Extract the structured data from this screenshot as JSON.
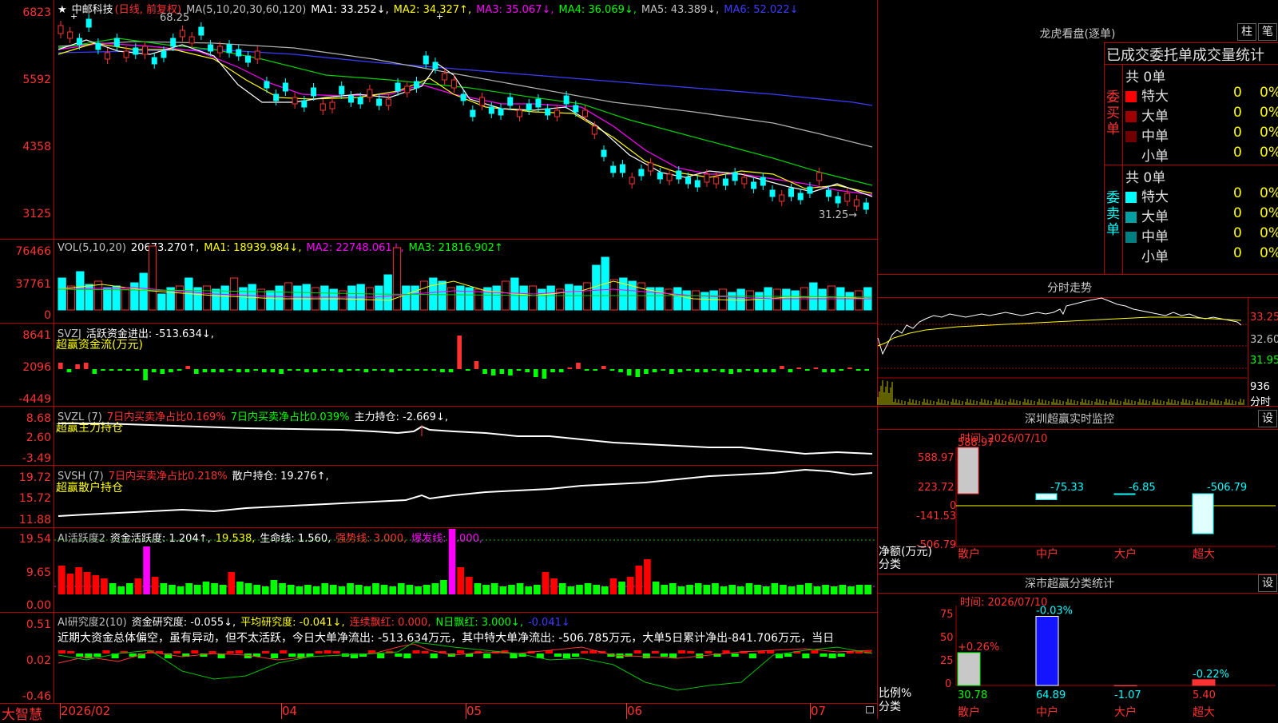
{
  "stock": {
    "star": "★",
    "name": "中邮科技",
    "period": "(日线, 前复权)",
    "high_mark": "68.25",
    "low_mark": "31.25→"
  },
  "ma_line": {
    "label": "MA(5,10,20,30,60,120)",
    "items": [
      {
        "text": "MA1: 33.252↓,",
        "color": "#ffffff"
      },
      {
        "text": "MA2: 34.327↑,",
        "color": "#ffff00"
      },
      {
        "text": "MA3: 35.067↓,",
        "color": "#ff00ff"
      },
      {
        "text": "MA4: 36.069↓,",
        "color": "#00ff00"
      },
      {
        "text": "MA5: 43.389↓,",
        "color": "#c0c0c0"
      },
      {
        "text": "MA6: 52.022↓",
        "color": "#3c3cff"
      }
    ]
  },
  "panels": {
    "kline": {
      "yticks": [
        "6823",
        "5592",
        "4358",
        "3125"
      ]
    },
    "vol": {
      "yticks": [
        "76466",
        "37761",
        "0"
      ],
      "label": "VOL(5,10,20)",
      "value": "20673.270↑,",
      "ma1": "MA1: 18939.984↓,",
      "ma2": "MA2: 22748.061↓,",
      "ma3": "MA3: 21816.902↑"
    },
    "svzj": {
      "yticks": [
        "8641",
        "2096",
        "-4449"
      ],
      "label": "SVZJ",
      "value": "活跃资金进出: -513.634↓,",
      "sub": "超赢资金流(万元)"
    },
    "svzl": {
      "yticks": [
        "8.68",
        "2.60",
        "-3.49"
      ],
      "label": "SVZL (7)",
      "a": "7日内买卖净占比0.169%",
      "b": "7日内买卖净占比0.039%",
      "c": "主力持仓: -2.669↓,",
      "sub": "超赢主力持仓"
    },
    "svsh": {
      "yticks": [
        "19.72",
        "15.72",
        "11.88"
      ],
      "label": "SVSH (7)",
      "a": "7日内买卖净占比0.218%",
      "b": "散户持仓: 19.276↑,",
      "sub": "超赢散户持仓"
    },
    "ai1": {
      "yticks": [
        "19.54",
        "9.65",
        "0.00"
      ],
      "label": "AI活跃度2",
      "a": "资金活跃度: 1.204↑,",
      "b": "19.538,",
      "c": "生命线: 1.560,",
      "d": "强势线: 3.000,",
      "e": "爆发线: 6.000,"
    },
    "ai2": {
      "yticks": [
        "0.51",
        "0.02",
        "-0.46"
      ],
      "label": "AI研究度2(10)",
      "a": "资金研究度: -0.055↓,",
      "b": "平均研究度: -0.041↓,",
      "c": "连续飘红: 0.000,",
      "d": "N日飘红: 3.000↓,",
      "e": "-0.041↓",
      "text": "近期大资金总体偏空，虽有异动，但不太活跃，今日大单净流出: -513.634万元，其中特大单净流出: -506.785万元，大单5日累计净出-841.706万元，当日"
    }
  },
  "bottom": {
    "brand": "大智慧",
    "dates": [
      "2026/02",
      "04",
      "05",
      "06",
      "07"
    ]
  },
  "dragon": {
    "title": "龙虎看盘(逐单)",
    "btn1": "柱",
    "btn2": "笔",
    "header": "已成交委托单成交量统计",
    "buy_label": "委买单",
    "sell_label": "委卖单",
    "buy_total": "共 0单",
    "sell_total": "共 0单",
    "buy_rows": [
      {
        "name": "特大",
        "num": "0",
        "pct": "0%",
        "color": "#ff0000"
      },
      {
        "name": "大单",
        "num": "0",
        "pct": "0%",
        "color": "#a00000"
      },
      {
        "name": "中单",
        "num": "0",
        "pct": "0%",
        "color": "#700000"
      },
      {
        "name": "小单",
        "num": "0",
        "pct": "0%",
        "color": "#000000"
      }
    ],
    "sell_rows": [
      {
        "name": "特大",
        "num": "0",
        "pct": "0%",
        "color": "#00ffff"
      },
      {
        "name": "大单",
        "num": "0",
        "pct": "0%",
        "color": "#00a0a0"
      },
      {
        "name": "中单",
        "num": "0",
        "pct": "0%",
        "color": "#008080"
      },
      {
        "name": "小单",
        "num": "0",
        "pct": "0%",
        "color": "#000000"
      }
    ]
  },
  "intraday": {
    "title": "分时走势",
    "p1": "33.25",
    "p2": "32.60",
    "p3": "31.95",
    "v": "936",
    "v2": "分时"
  },
  "monitor": {
    "title": "深圳超赢实时监控",
    "set": "设",
    "time": "时间: 2026/07/10",
    "yticks": [
      "588.97",
      "223.72",
      "0",
      "-141.53",
      "-506.79"
    ],
    "ylabel1": "净额(万元)",
    "ylabel2": "分类",
    "bars": [
      {
        "cat": "散户",
        "value": 588.97,
        "label": "588.97"
      },
      {
        "cat": "中户",
        "value": -75.33,
        "label": "-75.33"
      },
      {
        "cat": "大户",
        "value": -6.85,
        "label": "-6.85"
      },
      {
        "cat": "超大",
        "value": -506.79,
        "label": "-506.79"
      }
    ]
  },
  "classify": {
    "title": "深市超赢分类统计",
    "set": "设",
    "time": "时间: 2026/07/10",
    "yticks": [
      "75",
      "50",
      "25",
      "0"
    ],
    "ylabel1": "比例%",
    "ylabel2": "分类",
    "bars": [
      {
        "cat": "散户",
        "value": 30.78,
        "label": "30.78",
        "chg": "+0.26%"
      },
      {
        "cat": "中户",
        "value": 64.89,
        "label": "64.89",
        "chg": "-0.03%"
      },
      {
        "cat": "大户",
        "value": -1.07,
        "label": "-1.07",
        "chg": ""
      },
      {
        "cat": "超大",
        "value": 5.4,
        "label": "5.40",
        "chg": "-0.22%"
      }
    ]
  }
}
